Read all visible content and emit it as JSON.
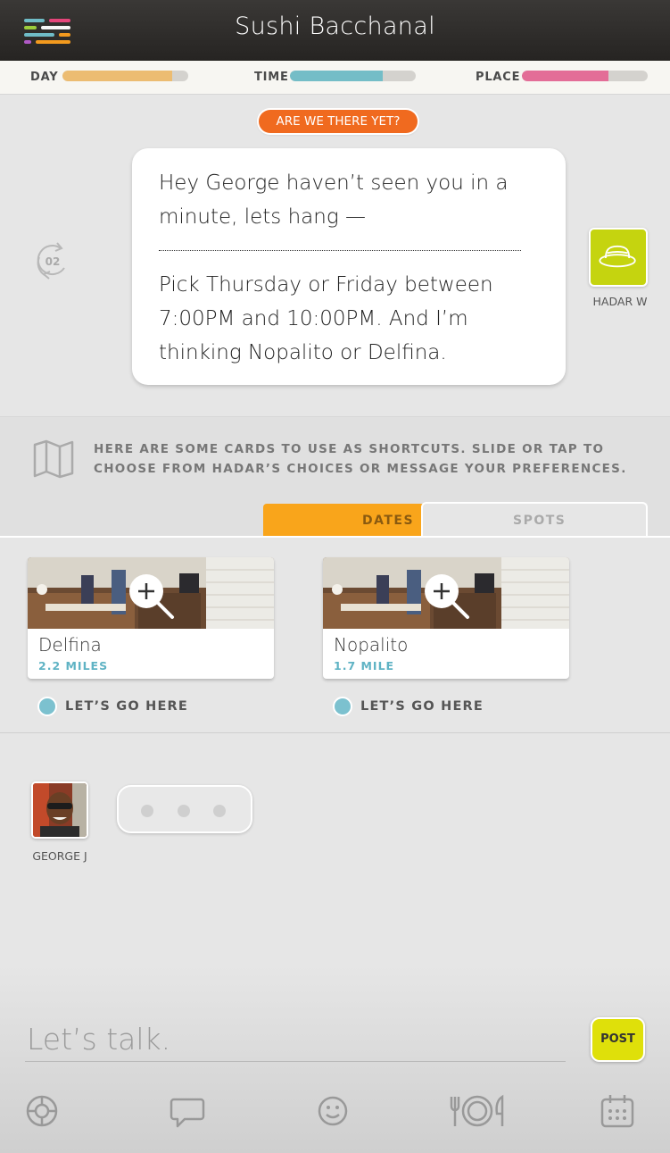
{
  "header": {
    "title": "Sushi Bacchanal"
  },
  "progress": [
    {
      "label": "DAY",
      "fraction": 0.87,
      "color": "#ecbc72"
    },
    {
      "label": "TIME",
      "fraction": 0.74,
      "color": "#74bdc7"
    },
    {
      "label": "PLACE",
      "fraction": 0.69,
      "color": "#e36d97"
    }
  ],
  "conversation": {
    "status_button": "ARE WE THERE YET?",
    "message_line1": "Hey George haven’t seen you in a minute, lets hang —",
    "message_line2": "Pick Thursday or Friday between 7:00PM and 10:00PM. And I’m thinking Nopalito or Delfina.",
    "round_count": "02",
    "sender_name": "HADAR W"
  },
  "hint": {
    "text": "HERE ARE SOME CARDS TO USE AS SHORTCUTS. SLIDE OR TAP TO CHOOSE FROM HADAR’S CHOICES OR MESSAGE YOUR PREFERENCES."
  },
  "tabs": {
    "dates": "DATES",
    "spots": "SPOTS"
  },
  "cards": [
    {
      "name": "Delfina",
      "distance": "2.2 MILES",
      "action": "LET’S GO HERE"
    },
    {
      "name": "Nopalito",
      "distance": "1.7 MILE",
      "action": "LET’S GO HERE"
    }
  ],
  "chat": {
    "user_name": "GEORGE J"
  },
  "composer": {
    "placeholder": "Let’s talk.",
    "post_label": "POST"
  },
  "colors": {
    "accent_orange": "#f06a1f",
    "tab_yellow": "#f9a51b",
    "post_yellow": "#dfe00a",
    "hat_green": "#c5d40f"
  },
  "nav": {
    "icons": [
      "support-icon",
      "chat-icon",
      "smiley-icon",
      "dining-icon",
      "calendar-icon"
    ]
  }
}
